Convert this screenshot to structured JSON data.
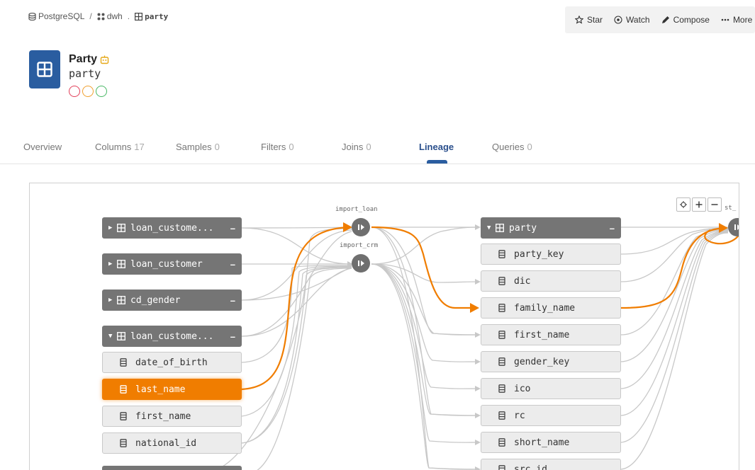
{
  "breadcrumb": {
    "db": "PostgreSQL",
    "separator": "/",
    "schema": "dwh",
    "dot": ".",
    "table": "party"
  },
  "actions": {
    "star": "Star",
    "watch": "Watch",
    "compose": "Compose",
    "more": "More"
  },
  "entity": {
    "title": "Party",
    "name": "party",
    "quality_colors": [
      "#e2405a",
      "#f0a030",
      "#4ab866"
    ]
  },
  "tabs": [
    {
      "label": "Overview",
      "count": ""
    },
    {
      "label": "Columns",
      "count": "17"
    },
    {
      "label": "Samples",
      "count": "0"
    },
    {
      "label": "Filters",
      "count": "0"
    },
    {
      "label": "Joins",
      "count": "0"
    },
    {
      "label": "Lineage",
      "count": ""
    },
    {
      "label": "Queries",
      "count": "0"
    }
  ],
  "active_tab": "Lineage",
  "lineage": {
    "processes": {
      "import_loan": "import_loan",
      "import_crm": "import_crm",
      "right_partial": "st_"
    },
    "source_tables": [
      {
        "label": "loan_custome...",
        "expanded": false
      },
      {
        "label": "loan_customer",
        "expanded": false
      },
      {
        "label": "cd_gender",
        "expanded": false
      },
      {
        "label": "loan_custome...",
        "expanded": true
      }
    ],
    "source_columns": [
      "date_of_birth",
      "last_name",
      "first_name",
      "national_id"
    ],
    "highlighted_source_column": "last_name",
    "target_table": "party",
    "target_columns": [
      "party_key",
      "dic",
      "family_name",
      "first_name",
      "gender_key",
      "ico",
      "rc",
      "short_name",
      "src_id"
    ],
    "highlighted_target_column": "family_name",
    "colors": {
      "highlight": "#f07d00",
      "edge": "#c8c8c8",
      "table_node": "#757575"
    }
  }
}
